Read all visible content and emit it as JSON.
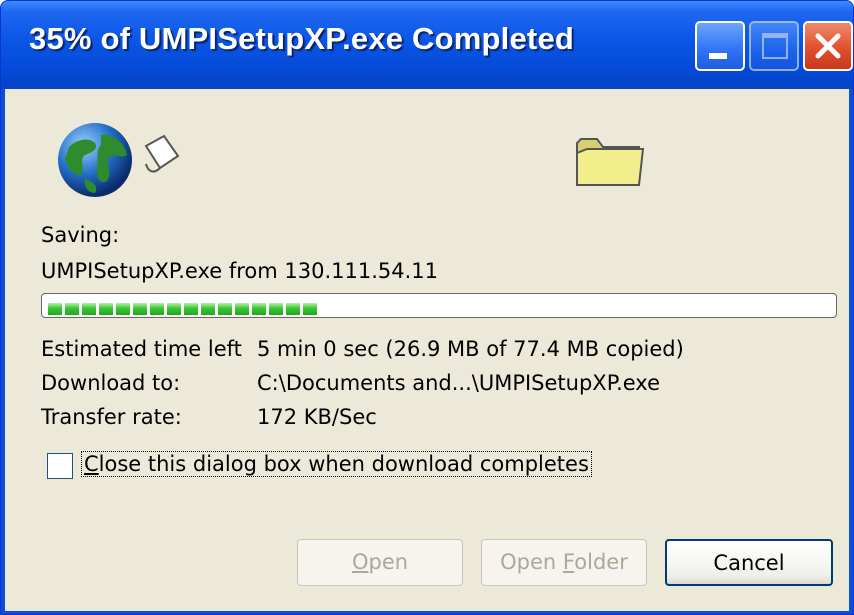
{
  "window": {
    "title": "35% of UMPISetupXP.exe Completed"
  },
  "status": {
    "saving_label": "Saving:",
    "file_source": "UMPISetupXP.exe from 130.111.54.11",
    "progress_percent": 35
  },
  "details": {
    "time_left_label": "Estimated time left",
    "time_left_value": "5 min 0 sec (26.9 MB of 77.4 MB copied)",
    "download_to_label": "Download to:",
    "download_to_value": "C:\\Documents and...\\UMPISetupXP.exe",
    "transfer_rate_label": "Transfer rate:",
    "transfer_rate_value": "172 KB/Sec"
  },
  "options": {
    "close_when_complete_label_pre": "",
    "close_when_complete_accel": "C",
    "close_when_complete_label_post": "lose this dialog box when download completes",
    "close_when_complete_checked": false
  },
  "buttons": {
    "open_accel": "O",
    "open_rest": "pen",
    "open_folder_pre": "Open ",
    "open_folder_accel": "F",
    "open_folder_rest": "older",
    "cancel": "Cancel"
  },
  "icons": {
    "globe": "globe-icon",
    "paper": "document-icon",
    "folder": "folder-icon",
    "minimize": "minimize-icon",
    "maximize": "maximize-icon",
    "close": "close-icon"
  },
  "colors": {
    "titlebar": "#0a56e6",
    "client_bg": "#ece9d8",
    "progress_green": "#36c632",
    "close_button": "#e0502e"
  }
}
